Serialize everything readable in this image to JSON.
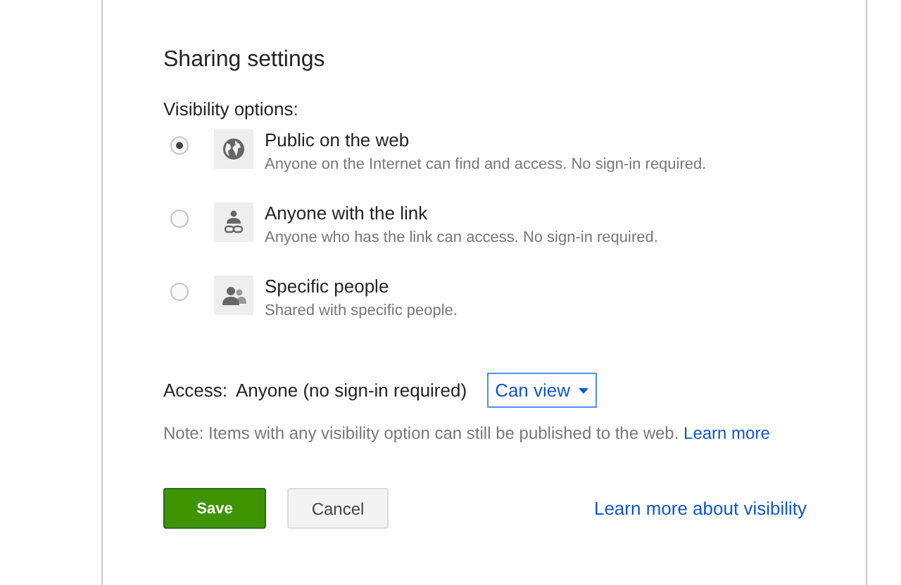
{
  "dialog": {
    "title": "Sharing settings",
    "section_label": "Visibility options:",
    "options": [
      {
        "kind": "globe",
        "label": "Public on the web",
        "description": "Anyone on the Internet can find and access. No sign-in required.",
        "selected": true
      },
      {
        "kind": "link",
        "label": "Anyone with the link",
        "description": "Anyone who has the link can access. No sign-in required.",
        "selected": false
      },
      {
        "kind": "people",
        "label": "Specific people",
        "description": "Shared with specific people.",
        "selected": false
      }
    ],
    "access": {
      "label": "Access:",
      "value": "Anyone (no sign-in required)",
      "dropdown": "Can view"
    },
    "note": {
      "text": "Note: Items with any visibility option can still be published to the web.",
      "link": "Learn more"
    },
    "buttons": [
      {
        "kind": "primary",
        "label": "Save"
      },
      {
        "kind": "secondary",
        "label": "Cancel"
      }
    ],
    "footer_link": "Learn more about visibility"
  }
}
